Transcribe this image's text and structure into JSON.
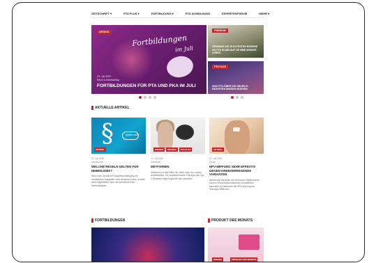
{
  "nav": {
    "items": [
      {
        "label": "ZEITSCHRIFT ▾"
      },
      {
        "label": "PTA PLUS ▾"
      },
      {
        "label": "FORTBILDUNG ▾"
      },
      {
        "label": "PTA AUSBILDUNG"
      },
      {
        "label": "EXPERTENFORUM"
      },
      {
        "label": "MEHR ▾"
      }
    ]
  },
  "hero": {
    "tag": "ARTIKEL",
    "script_line1": "Fortbildungen",
    "script_line2": "im Juli",
    "date": "23. Juli 2025",
    "sub": "Beruf & Arbeitsalltag",
    "headline": "FORTBILDUNGEN FÜR PTA UND PKA IM JULI"
  },
  "side_cards": [
    {
      "tag": "PREMIUM",
      "title": "GEWINNE DIE 25 ÄLTESTEN BIOMINE AN PTA IN ABLAUF DE MIMI WIEDER LEBEN"
    },
    {
      "tag": "PTA PLUS",
      "title": "WAS PTA ÜBER DIE NEUEN E-REZEPTEN WISSEN MÜSSEN"
    }
  ],
  "sections": {
    "aktuelle": "AKTUELLE ARTIKEL",
    "fortbildungen": "FORTBILDUNGEN",
    "produkt": "PRODUKT DES MONATS"
  },
  "articles": [
    {
      "tags": [
        "ARTIKEL"
      ],
      "image_text": "Arbeits recht",
      "date": "22. Juli 2025",
      "category": "Arbeitsrecht",
      "title": "WELCHE REGELN GELTEN FÜR NEBENJOBS?",
      "excerpt": "Wenn das Gehalt der Hauptbeschäftigung die monatlichen Ausgaben nicht abdecken kann, denken viele Angestellten über die Aufnahme einer Nebentätigkeit..."
    },
    {
      "tags": [
        "WISSEN",
        "ARTIKEL",
        "PTA PLUS"
      ],
      "date": "10. Juli 2025",
      "category": "Steckbrief",
      "title": "METFORMIN",
      "excerpt": "Metformin ist das Mittel der Wahl unter den oralen Antidiabetika. Die medikamentöse Therapie des Typ-2-Diabetes beginnt gemäß den aktuellen..."
    },
    {
      "tags": [
        "ARTIKEL"
      ],
      "date": "22. Juli 2025",
      "category": "Studie",
      "title": "HPV-IMPFUNG SEHR EFFEKTIV GEGEN KREBSERREGENDE VARIANTEN",
      "excerpt": "Bestimmte Varianten der Humanen Papillomviren können Gebärmutterhalskrebs verursachen. Nachdem in Dänemark die HPV-Impfung bei Teenager-Mädchen..."
    }
  ],
  "produkt": {
    "tags": [
      "WISSEN",
      "PRODUKT DES MONATS"
    ]
  }
}
